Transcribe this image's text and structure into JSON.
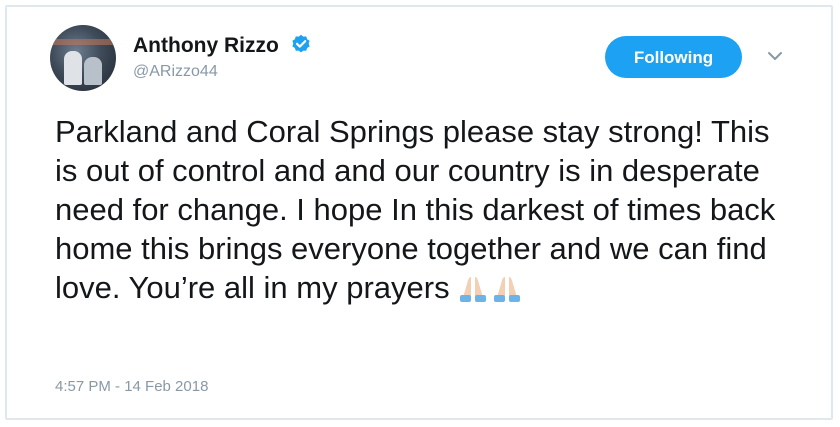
{
  "tweet": {
    "author_name": "Anthony Rizzo",
    "handle": "@ARizzo44",
    "verified": true,
    "follow_button_label": "Following",
    "text": "Parkland and Coral Springs please stay strong! This is out of control and and our country is in desperate need for change. I hope In this darkest of times back home this brings everyone together and we can find love. You’re all in my prayers",
    "emoji": [
      "folded-hands-icon",
      "folded-hands-icon"
    ],
    "timestamp": "4:57 PM - 14 Feb 2018"
  },
  "colors": {
    "accent": "#1da1f2",
    "text_primary": "#14171a",
    "text_secondary": "#8899a6",
    "border": "#e1e8ed"
  },
  "icons": {
    "verified": "verified-badge-icon",
    "more": "chevron-down-icon"
  }
}
